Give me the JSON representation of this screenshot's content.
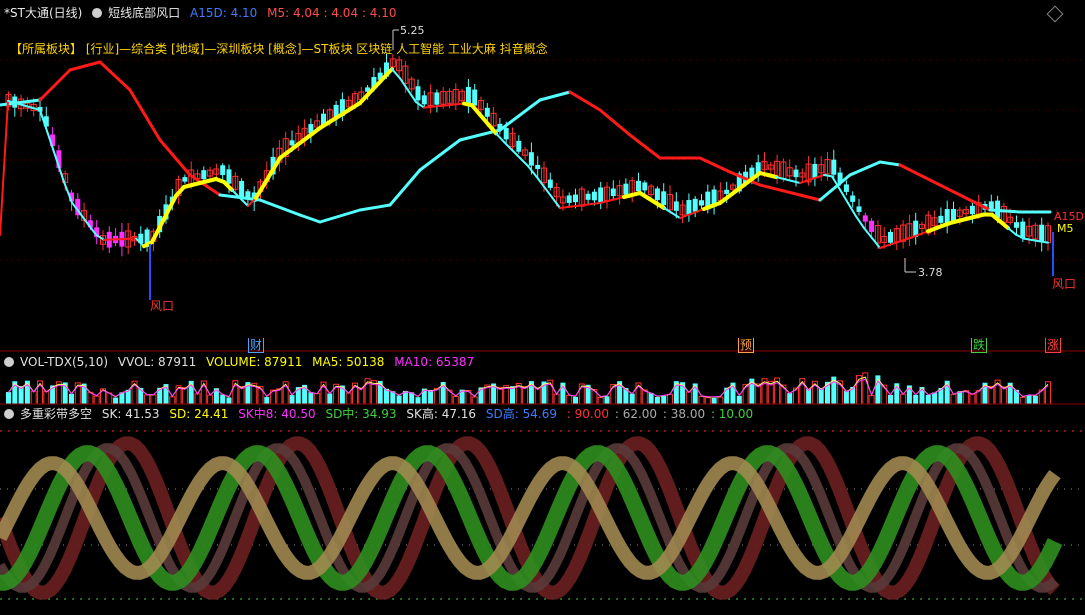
{
  "header": {
    "stock_name": "*ST大通",
    "period": "(日线)",
    "indicator_name": "短线底部风口",
    "a15d_label": "A15D: 4.10",
    "m5_label": "M5: 4.04 : 4.04 : 4.10"
  },
  "sector_line": "【所属板块】 [行业]—综合类 [地域]—深圳板块 [概念]—ST板块 区块链 人工智能 工业大麻 抖音概念",
  "price_chart": {
    "high_annotation": "5.25",
    "low_annotation": "3.78",
    "fengkou_labels": [
      "风口",
      "风口"
    ],
    "right_labels": [
      "A15D",
      "M5"
    ]
  },
  "events": [
    {
      "label": "财",
      "color": "#4aa3ff"
    },
    {
      "label": "预",
      "color": "#ffa040"
    },
    {
      "label": "跌",
      "color": "#3fd13f"
    },
    {
      "label": "涨",
      "color": "#ff4040"
    }
  ],
  "volume_panel": {
    "name": "VOL-TDX(5,10)",
    "vvol": "VVOL: 87911",
    "volume": "VOLUME: 87911",
    "ma5": "MA5: 50138",
    "ma10": "MA10: 65387"
  },
  "osc_panel": {
    "name": "多重彩带多空",
    "sk": "SK: 41.53",
    "sd": "SD: 24.41",
    "sk_mid8": "SK中8: 40.50",
    "sd_mid": "SD中: 34.93",
    "sk_high": "SK高: 47.16",
    "sd_high": "SD高: 54.69",
    "level_90": ": 90.00",
    "level_62": ": 62.00",
    "level_38": ": 38.00",
    "level_10": ": 10.00"
  },
  "colors": {
    "up": "#ff3030",
    "down": "#54ffff",
    "magenta": "#ff30ff",
    "ma_yellow": "#ffff00",
    "border": "#8b0000"
  }
}
